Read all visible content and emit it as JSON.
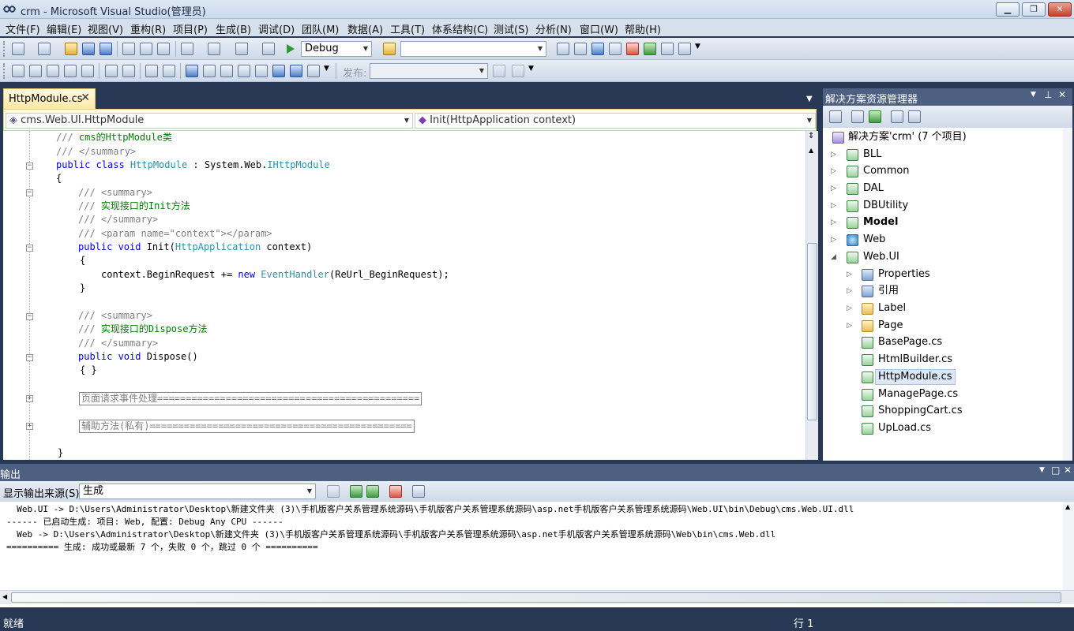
{
  "window": {
    "title": "crm - Microsoft Visual Studio(管理员)",
    "buttons": {
      "minimize": "▁",
      "restore": "❐",
      "close": "✕"
    }
  },
  "menu": [
    "文件(F)",
    "编辑(E)",
    "视图(V)",
    "重构(R)",
    "项目(P)",
    "生成(B)",
    "调试(D)",
    "团队(M)",
    "数据(A)",
    "工具(T)",
    "体系结构(C)",
    "测试(S)",
    "分析(N)",
    "窗口(W)",
    "帮助(H)"
  ],
  "toolbar": {
    "config_value": "Debug",
    "platform_value": "",
    "publish_label": "发布:",
    "publish_value": ""
  },
  "editor": {
    "tab_label": "HttpModule.cs",
    "tab_close": "✕",
    "type_combo": "cms.Web.UI.HttpModule",
    "member_combo": "Init(HttpApplication context)",
    "code_lines": {
      "l0": "cms的HttpModule类",
      "l1": "</summary>",
      "l2_kw": "public class ",
      "l2_type": "HttpModule",
      "l2_mid": " : System.Web.",
      "l2_iface": "IHttpModule",
      "l3": "{",
      "l4": "<summary>",
      "l5": "实现接口的Init方法",
      "l6": "</summary>",
      "l7": "<param name=\"context\"></param>",
      "l8_kw": "public void ",
      "l8_name": "Init(",
      "l8_type": "HttpApplication",
      "l8_end": " context)",
      "l9": "{",
      "l10_a": "context.BeginRequest += ",
      "l10_kw": "new ",
      "l10_type": "EventHandler",
      "l10_end": "(ReUrl_BeginRequest);",
      "l11": "}",
      "l13": "<summary>",
      "l14": "实现接口的Dispose方法",
      "l15": "</summary>",
      "l16_kw": "public void ",
      "l16_name": "Dispose()",
      "l17": "{ }",
      "region1": "页面请求事件处理==============================================",
      "region2": "辅助方法(私有)==============================================",
      "l22": "}"
    }
  },
  "solution_explorer": {
    "title": "解决方案资源管理器",
    "root": "解决方案'crm' (7 个项目)",
    "projects": [
      "BLL",
      "Common",
      "DAL",
      "DBUtility",
      "Model",
      "Web",
      "Web.UI"
    ],
    "webui_children": [
      "Properties",
      "引用",
      "Label",
      "Page",
      "BasePage.cs",
      "HtmlBuilder.cs",
      "HttpModule.cs",
      "ManagePage.cs",
      "ShoppingCart.cs",
      "UpLoad.cs"
    ]
  },
  "output": {
    "title": "输出",
    "source_label": "显示输出来源(S):",
    "source_value": "生成",
    "lines": [
      "  Web.UI -> D:\\Users\\Administrator\\Desktop\\新建文件夹 (3)\\手机版客户关系管理系统源码\\手机版客户关系管理系统源码\\asp.net手机版客户关系管理系统源码\\Web.UI\\bin\\Debug\\cms.Web.UI.dll",
      "------ 已启动生成: 项目: Web, 配置: Debug Any CPU ------",
      "  Web -> D:\\Users\\Administrator\\Desktop\\新建文件夹 (3)\\手机版客户关系管理系统源码\\手机版客户关系管理系统源码\\asp.net手机版客户关系管理系统源码\\Web\\bin\\cms.Web.dll",
      "========== 生成: 成功或最新 7 个，失败 0 个，跳过 0 个 =========="
    ]
  },
  "status": {
    "left": "就绪",
    "line": "行 1"
  }
}
